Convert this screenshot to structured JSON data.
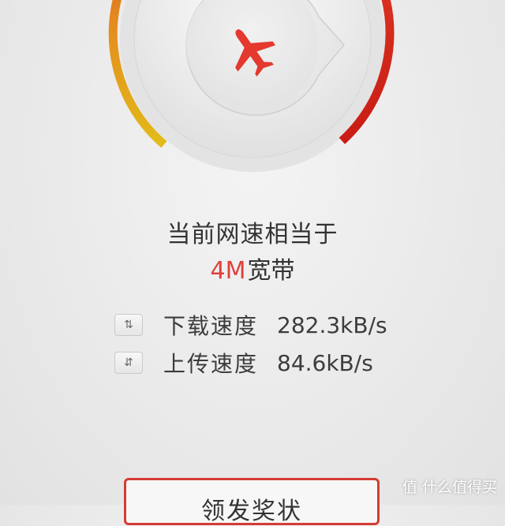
{
  "gauge": {
    "icon": "airplane-icon",
    "colors": {
      "low": "#e0b020",
      "high": "#d8221a"
    }
  },
  "result": {
    "headline": "当前网速相当于",
    "bandwidth_value": "4M",
    "bandwidth_unit": "宽带",
    "highlight_color": "#e0403a"
  },
  "speeds": {
    "download": {
      "icon": "download-arrows-icon",
      "label": "下载速度",
      "value": "282.3kB/s"
    },
    "upload": {
      "icon": "upload-arrows-icon",
      "label": "上传速度",
      "value": "84.6kB/s"
    }
  },
  "action": {
    "button_label": "领发奖状"
  },
  "watermark": {
    "text": "值 什么值得买"
  }
}
